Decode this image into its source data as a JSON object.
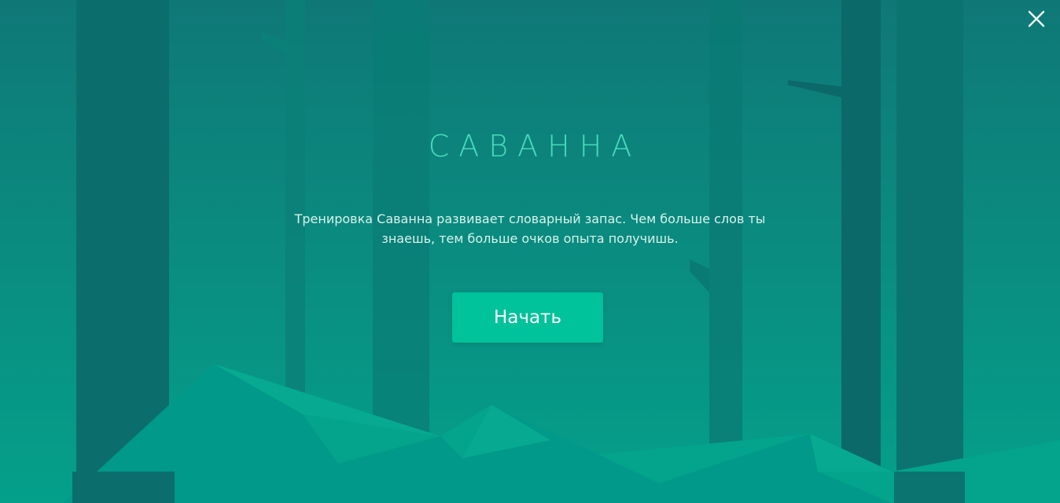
{
  "game": {
    "title": "САВАННА",
    "description": "Тренировка Саванна развивает словарный запас. Чем больше слов ты знаешь, тем больше очков опыта получишь.",
    "start_label": "Начать"
  },
  "colors": {
    "background_top": "#0f7877",
    "background_bottom": "#04a08a",
    "title": "#49d9ba",
    "button": "#00c29b"
  },
  "icons": {
    "close": "close-icon"
  }
}
